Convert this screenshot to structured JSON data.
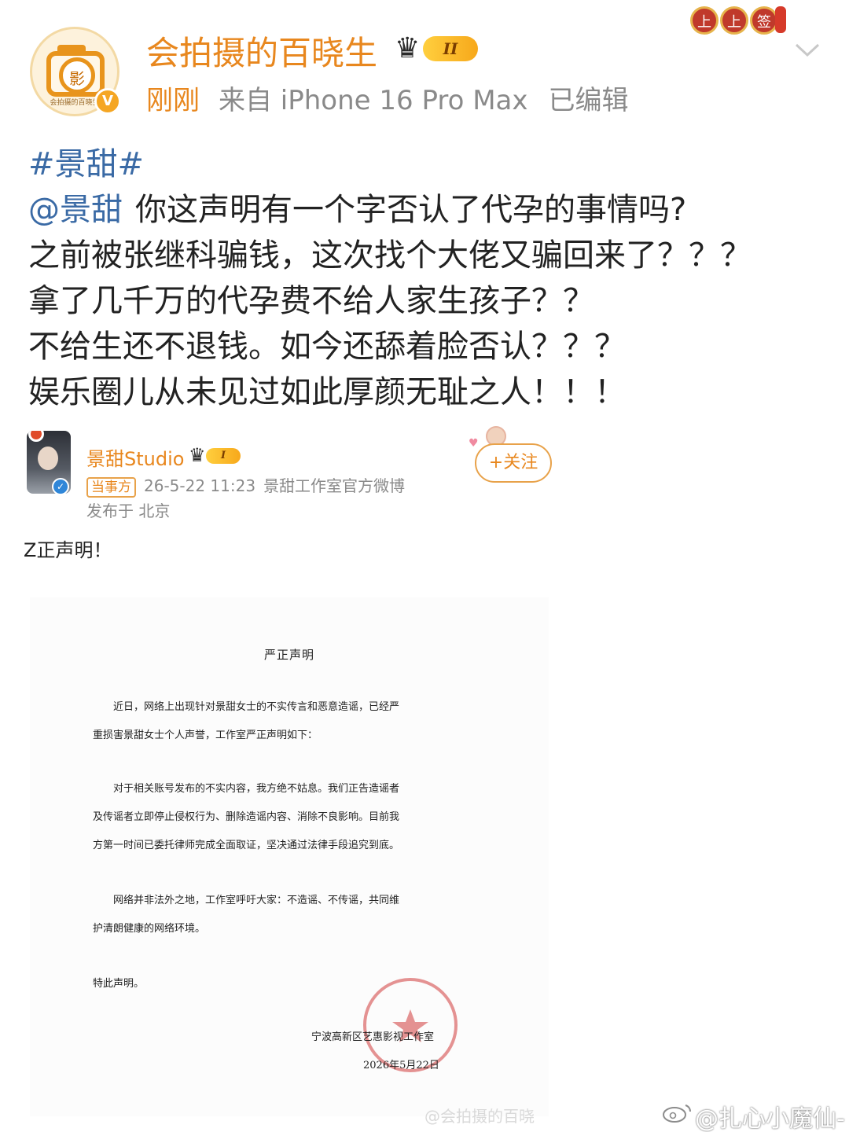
{
  "author": {
    "name": "会拍摄的百晓生",
    "avatar_caption": "会拍摄的百晓生",
    "avatar_glyph": "影",
    "level_badge": "II",
    "verified_mark": "V",
    "time": "刚刚",
    "source": "来自 iPhone 16 Pro Max",
    "edited": "已编辑"
  },
  "decoration": {
    "seals": [
      "上",
      "上",
      "签"
    ]
  },
  "post": {
    "hashtag": "#景甜#",
    "mention": "@景甜",
    "lines": [
      "你这声明有一个字否认了代孕的事情吗?",
      "之前被张继科骗钱，这次找个大佬又骗回来了？？？",
      "拿了几千万的代孕费不给人家生孩子？？",
      "不给生还不退钱。如今还舔着脸否认？？？",
      "娱乐圈儿从未见过如此厚颜无耻之人！！！"
    ]
  },
  "embedded": {
    "name": "景甜Studio",
    "level_badge": "I",
    "tag": "当事方",
    "datetime": "26-5-22 11:23",
    "source": "景甜工作室官方微博",
    "location": "发布于 北京",
    "follow_label": "+关注",
    "title": "Z正声明！"
  },
  "document": {
    "title": "严正声明",
    "paragraphs": [
      [
        "近日，网络上出现针对景甜女士的不实传言和恶意造谣，已经严",
        "重损害景甜女士个人声誉，工作室严正声明如下："
      ],
      [
        "对于相关账号发布的不实内容，我方绝不姑息。我们正告造谣者",
        "及传谣者立即停止侵权行为、删除造谣内容、消除不良影响。目前我",
        "方第一时间已委托律师完成全面取证，坚决通过法律手段追究到底。"
      ],
      [
        "网络并非法外之地，工作室呼吁大家：不造谣、不传谣，共同维",
        "护清朗健康的网络环境。"
      ],
      [
        "特此声明。"
      ]
    ],
    "org": "宁波高新区艺惠影视工作室",
    "date": "2026年5月22日",
    "stamp_text": "宁波高新区艺惠影视工作室"
  },
  "watermarks": {
    "image": "@会拍摄的百晓",
    "screenshot": "@扎心小魔仙-"
  },
  "colors": {
    "accent_orange": "#e8871e",
    "link_blue": "#3a6aa5",
    "meta_gray": "#8a8a8a"
  }
}
